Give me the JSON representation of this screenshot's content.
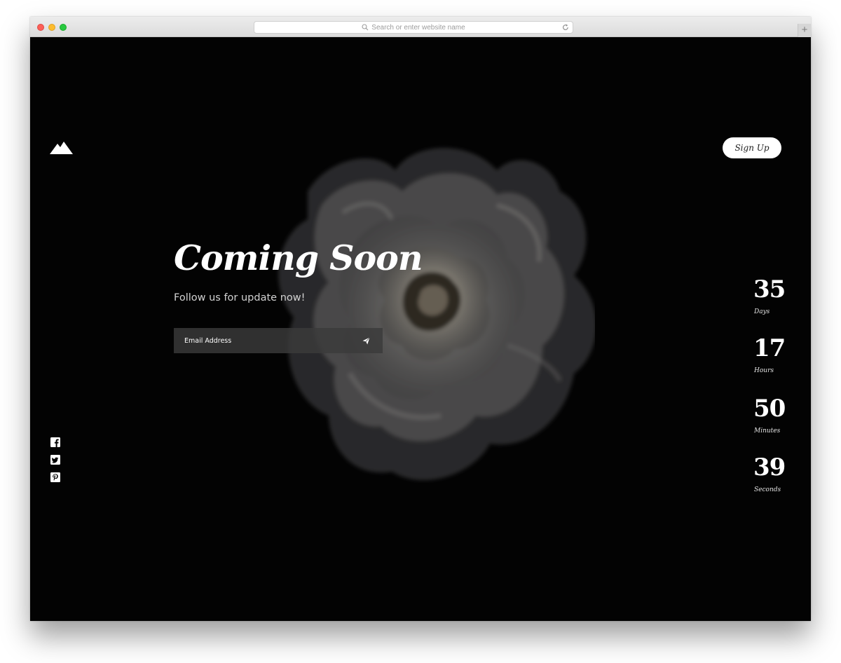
{
  "browser": {
    "address_placeholder": "Search or enter website name",
    "new_tab_label": "+"
  },
  "header": {
    "logo_icon": "mountain-icon",
    "signup_label": "Sign Up"
  },
  "hero": {
    "title": "Coming Soon",
    "subtitle": "Follow us for update now!",
    "email_placeholder": "Email Address",
    "send_icon": "paper-plane-icon",
    "background_image": "rose"
  },
  "social": [
    {
      "name": "facebook",
      "icon": "facebook-icon"
    },
    {
      "name": "twitter",
      "icon": "twitter-icon"
    },
    {
      "name": "pinterest",
      "icon": "pinterest-icon"
    }
  ],
  "countdown": {
    "days": {
      "value": "35",
      "label": "Days"
    },
    "hours": {
      "value": "17",
      "label": "Hours"
    },
    "minutes": {
      "value": "50",
      "label": "Minutes"
    },
    "seconds": {
      "value": "39",
      "label": "Seconds"
    }
  },
  "colors": {
    "background": "#030303",
    "text": "#ffffff",
    "form_background": "#3a3a3a",
    "button_background": "#ffffff"
  }
}
